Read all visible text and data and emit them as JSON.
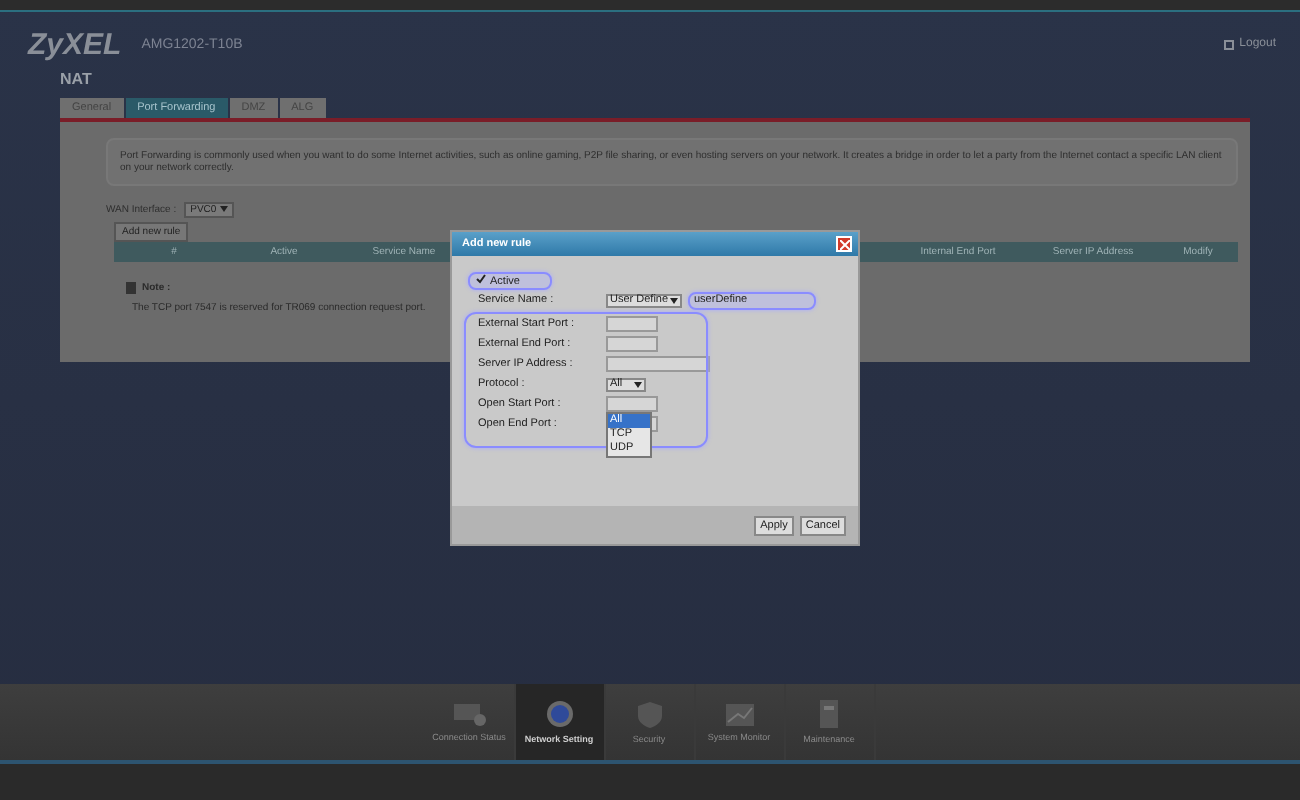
{
  "header": {
    "logo": "ZyXEL",
    "model": "AMG1202-T10B",
    "logout": "Logout"
  },
  "page_title": "NAT",
  "tabs": [
    {
      "label": "General",
      "selected": false
    },
    {
      "label": "Port Forwarding",
      "selected": true
    },
    {
      "label": "DMZ",
      "selected": false
    },
    {
      "label": "ALG",
      "selected": false
    }
  ],
  "info": "Port Forwarding is commonly used when you want to do some Internet activities, such as online gaming, P2P file sharing, or even hosting servers on your network. It creates a bridge in order to let a party from the Internet contact a specific LAN client on your network correctly.",
  "wan_interface": {
    "label": "WAN Interface :",
    "value": "PVC0"
  },
  "add_button": "Add new rule",
  "table": {
    "columns_left": [
      "#",
      "Active",
      "Service Name"
    ],
    "columns_right": [
      "Internal End Port",
      "Server IP Address",
      "Modify"
    ]
  },
  "note": {
    "title": "Note :",
    "text": "The TCP port 7547 is reserved for TR069 connection request port."
  },
  "dialog": {
    "title": "Add new rule",
    "active": {
      "label": "Active",
      "checked": true
    },
    "fields": [
      {
        "kind": "service",
        "label": "Service Name :",
        "value": "User Define",
        "text": "userDefine"
      },
      {
        "kind": "short",
        "label": "External Start Port :"
      },
      {
        "kind": "short",
        "label": "External End Port :"
      },
      {
        "kind": "long",
        "label": "Server IP Address :"
      },
      {
        "kind": "select",
        "label": "Protocol :",
        "value": "All",
        "options": [
          {
            "label": "All",
            "selected": true
          },
          {
            "label": "TCP",
            "selected": false
          },
          {
            "label": "UDP",
            "selected": false
          }
        ]
      },
      {
        "kind": "short",
        "label": "Open Start Port :"
      },
      {
        "kind": "short",
        "label": "Open End Port :"
      }
    ],
    "buttons": [
      "Apply",
      "Cancel"
    ]
  },
  "nav": [
    {
      "label": "Connection Status",
      "selected": false
    },
    {
      "label": "Network Setting",
      "selected": true
    },
    {
      "label": "Security",
      "selected": false
    },
    {
      "label": "System Monitor",
      "selected": false
    },
    {
      "label": "Maintenance",
      "selected": false
    }
  ]
}
